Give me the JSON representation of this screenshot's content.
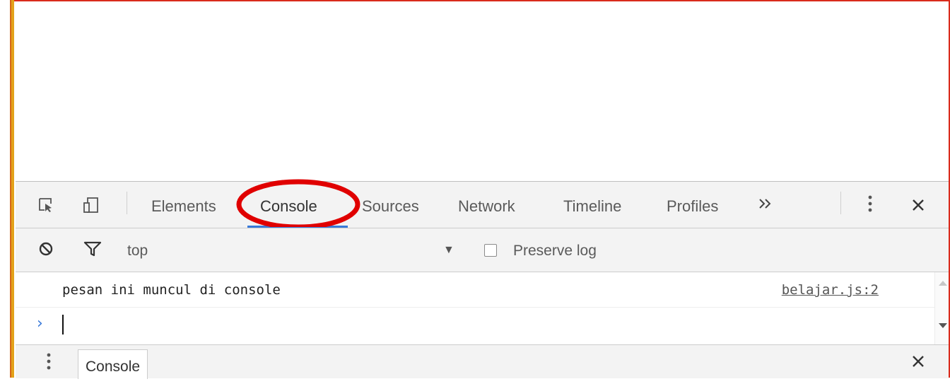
{
  "devtools": {
    "tabs": [
      "Elements",
      "Console",
      "Sources",
      "Network",
      "Timeline",
      "Profiles"
    ],
    "active_tab": "Console",
    "more_tabs_icon": "double-chevron-right-icon",
    "menu_icon": "vertical-ellipsis-icon",
    "close_icon": "close-icon"
  },
  "console_toolbar": {
    "clear_icon": "clear-console-icon",
    "filter_icon": "filter-icon",
    "context": "top",
    "preserve_log_label": "Preserve log",
    "preserve_log_checked": false
  },
  "console": {
    "messages": [
      {
        "text": "pesan ini muncul di console",
        "source": "belajar.js:2"
      }
    ],
    "prompt_symbol": "›"
  },
  "drawer": {
    "tab_label": "Console"
  },
  "colors": {
    "accent": "#3879d9",
    "highlight": "#e00000",
    "frame_border": "#d92b1c"
  }
}
